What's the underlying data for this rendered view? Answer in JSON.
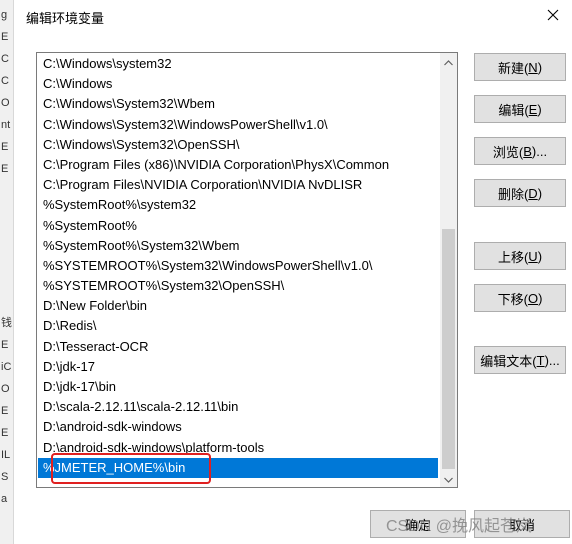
{
  "dialog": {
    "title": "编辑环境变量",
    "selected_index": 20,
    "paths": [
      "C:\\Windows\\system32",
      "C:\\Windows",
      "C:\\Windows\\System32\\Wbem",
      "C:\\Windows\\System32\\WindowsPowerShell\\v1.0\\",
      "C:\\Windows\\System32\\OpenSSH\\",
      "C:\\Program Files (x86)\\NVIDIA Corporation\\PhysX\\Common",
      "C:\\Program Files\\NVIDIA Corporation\\NVIDIA NvDLISR",
      "%SystemRoot%\\system32",
      "%SystemRoot%",
      "%SystemRoot%\\System32\\Wbem",
      "%SYSTEMROOT%\\System32\\WindowsPowerShell\\v1.0\\",
      "%SYSTEMROOT%\\System32\\OpenSSH\\",
      "D:\\New Folder\\bin",
      "D:\\Redis\\",
      "D:\\Tesseract-OCR",
      "D:\\jdk-17",
      "D:\\jdk-17\\bin",
      "D:\\scala-2.12.11\\scala-2.12.11\\bin",
      "D:\\android-sdk-windows",
      "D:\\android-sdk-windows\\platform-tools",
      "%JMETER_HOME%\\bin"
    ],
    "buttons": {
      "new": {
        "label": "新建(",
        "key": "N",
        "suffix": ")"
      },
      "edit": {
        "label": "编辑(",
        "key": "E",
        "suffix": ")"
      },
      "browse": {
        "label": "浏览(",
        "key": "B",
        "suffix": ")..."
      },
      "delete": {
        "label": "删除(",
        "key": "D",
        "suffix": ")"
      },
      "move_up": {
        "label": "上移(",
        "key": "U",
        "suffix": ")"
      },
      "move_down": {
        "label": "下移(",
        "key": "O",
        "suffix": ")"
      },
      "edit_text": {
        "label": "编辑文本(",
        "key": "T",
        "suffix": ")..."
      }
    },
    "footer": {
      "ok": "确定",
      "cancel": "取消"
    },
    "watermark": "CSDN @挽风起苍岚"
  },
  "background_window": {
    "chars": [
      "g",
      "E",
      "C",
      "C",
      "O",
      "nt",
      "E",
      "E",
      "",
      "",
      "",
      "",
      "",
      "",
      "钱",
      "E",
      "iC",
      "O",
      "E",
      "E",
      "IL",
      "S",
      "a"
    ]
  },
  "colors": {
    "selection": "#0078d7",
    "highlight_box": "#e02020"
  },
  "icons": {
    "close": "close-icon",
    "scroll_up": "chevron-up-icon",
    "scroll_down": "chevron-down-icon"
  }
}
